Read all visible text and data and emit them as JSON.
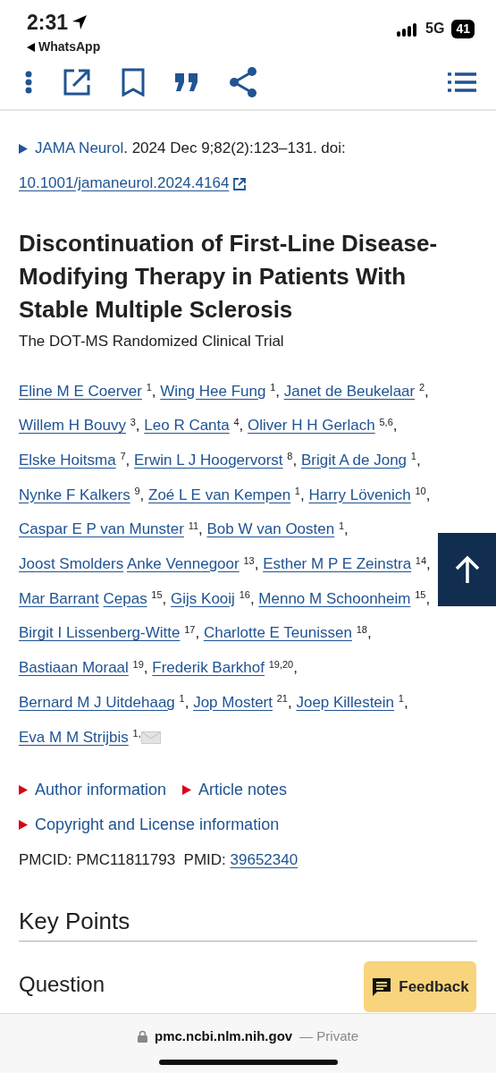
{
  "status_bar": {
    "time": "2:31",
    "back_app": "WhatsApp",
    "network": "5G",
    "battery": "41"
  },
  "toolbar": {
    "buttons": [
      {
        "kind": "more"
      },
      {
        "kind": "open"
      },
      {
        "kind": "bookmark"
      },
      {
        "kind": "cite"
      },
      {
        "kind": "share"
      },
      {
        "kind": "spacer"
      },
      {
        "kind": "contents"
      }
    ]
  },
  "citation": {
    "journal": "JAMA Neurol",
    "details": ". 2024 Dec 9;82(2):123–131. doi:",
    "doi": "10.1001/jamaneurol.2024.4164"
  },
  "article": {
    "title": "Discontinuation of First-Line Disease-Modifying Therapy in Patients With Stable Multiple Sclerosis",
    "subtitle": "The DOT-MS Randomized Clinical Trial"
  },
  "authors": [
    {
      "name": "Eline M E Coerver",
      "affiliations": "1",
      "separator": ","
    },
    {
      "name": "Wing Hee Fung",
      "affiliations": "1",
      "separator": ","
    },
    {
      "name": "Janet de Beukelaar",
      "affiliations": "2",
      "separator": ","
    },
    {
      "name": "Willem H Bouvy",
      "affiliations": "3",
      "separator": ","
    },
    {
      "name": "Leo R Canta",
      "affiliations": "4",
      "separator": ","
    },
    {
      "name": "Oliver H H Gerlach",
      "affiliations": "5,6",
      "separator": ","
    },
    {
      "name": "Elske Hoitsma",
      "affiliations": "7",
      "separator": ","
    },
    {
      "name": "Erwin L J Hoogervorst",
      "affiliations": "8",
      "separator": ","
    },
    {
      "name": "Brigit A de Jong",
      "affiliations": "1",
      "separator": ","
    },
    {
      "name": "Nynke F Kalkers",
      "affiliations": "9",
      "separator": ","
    },
    {
      "name": "Zoé L E van Kempen",
      "affiliations": "1",
      "separator": ","
    },
    {
      "name": "Harry Lövenich",
      "affiliations": "10",
      "separator": ","
    },
    {
      "name": "Caspar E P van Munster",
      "affiliations": "11",
      "separator": ","
    },
    {
      "name": "Bob W van Oosten",
      "affiliations": "1",
      "separator": ","
    },
    {
      "name": "Joost Smolders"
    },
    {
      "name": "Anke Vennegoor",
      "affiliations": "13",
      "separator": ","
    },
    {
      "name": "Esther M P E Zeinstra",
      "affiliations": "14",
      "separator": ","
    },
    {
      "name": "Mar Barrant"
    },
    {
      "name": "Cepas",
      "affiliations": "15",
      "separator": ","
    },
    {
      "name": "Gijs Kooij",
      "affiliations": "16",
      "separator": ","
    },
    {
      "name": "Menno M Schoonheim",
      "affiliations": "15",
      "separator": ","
    },
    {
      "name": "Birgit I Lissenberg-Witte",
      "affiliations": "17",
      "separator": ","
    },
    {
      "name": "Charlotte E Teunissen",
      "affiliations": "18",
      "separator": ","
    },
    {
      "name": "Bastiaan Moraal",
      "affiliations": "19",
      "separator": ","
    },
    {
      "name": "Frederik Barkhof",
      "affiliations": "19,20",
      "separator": ","
    },
    {
      "name": "Bernard M J Uitdehaag",
      "affiliations": "1",
      "separator": ","
    },
    {
      "name": "Jop Mostert",
      "affiliations": "21",
      "separator": ","
    },
    {
      "name": "Joep Killestein",
      "affiliations": "1",
      "separator": ","
    },
    {
      "name": "Eva M M Strijbis",
      "affiliations": "1,",
      "email": true
    }
  ],
  "sections": [
    {
      "label": "Author information",
      "expanded": false
    },
    {
      "label": "Article notes",
      "expanded": false
    },
    {
      "label": "Copyright and License information",
      "expanded": false
    }
  ],
  "ids": {
    "pmcid": "PMCID: PMC11811793",
    "pmid_label": "PMID:",
    "pmid": "39652340"
  },
  "headings": [
    "Key Points",
    "Question"
  ],
  "feedback": "Feedback",
  "address_bar": {
    "domain": "pmc.ncbi.nlm.nih.gov",
    "mode": "— Private"
  }
}
